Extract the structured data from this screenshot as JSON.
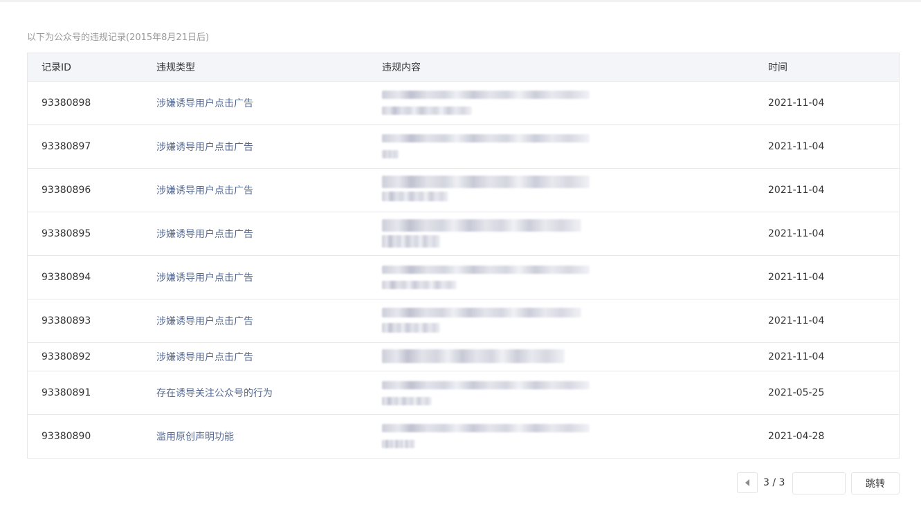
{
  "caption": "以下为公众号的违规记录(2015年8月21日后)",
  "table": {
    "headers": {
      "id": "记录ID",
      "type": "违规类型",
      "content": "违规内容",
      "time": "时间"
    },
    "rows": [
      {
        "id": "93380898",
        "type": "涉嫌诱导用户点击广告",
        "time": "2021-11-04"
      },
      {
        "id": "93380897",
        "type": "涉嫌诱导用户点击广告",
        "time": "2021-11-04"
      },
      {
        "id": "93380896",
        "type": "涉嫌诱导用户点击广告",
        "time": "2021-11-04"
      },
      {
        "id": "93380895",
        "type": "涉嫌诱导用户点击广告",
        "time": "2021-11-04"
      },
      {
        "id": "93380894",
        "type": "涉嫌诱导用户点击广告",
        "time": "2021-11-04"
      },
      {
        "id": "93380893",
        "type": "涉嫌诱导用户点击广告",
        "time": "2021-11-04"
      },
      {
        "id": "93380892",
        "type": "涉嫌诱导用户点击广告",
        "time": "2021-11-04"
      },
      {
        "id": "93380891",
        "type": "存在诱导关注公众号的行为",
        "time": "2021-05-25"
      },
      {
        "id": "93380890",
        "type": "滥用原创声明功能",
        "time": "2021-04-28"
      }
    ]
  },
  "pagination": {
    "page_indicator": "3 / 3",
    "jump_input_value": "",
    "jump_label": "跳转",
    "prev_icon": "triangle-left-icon"
  }
}
